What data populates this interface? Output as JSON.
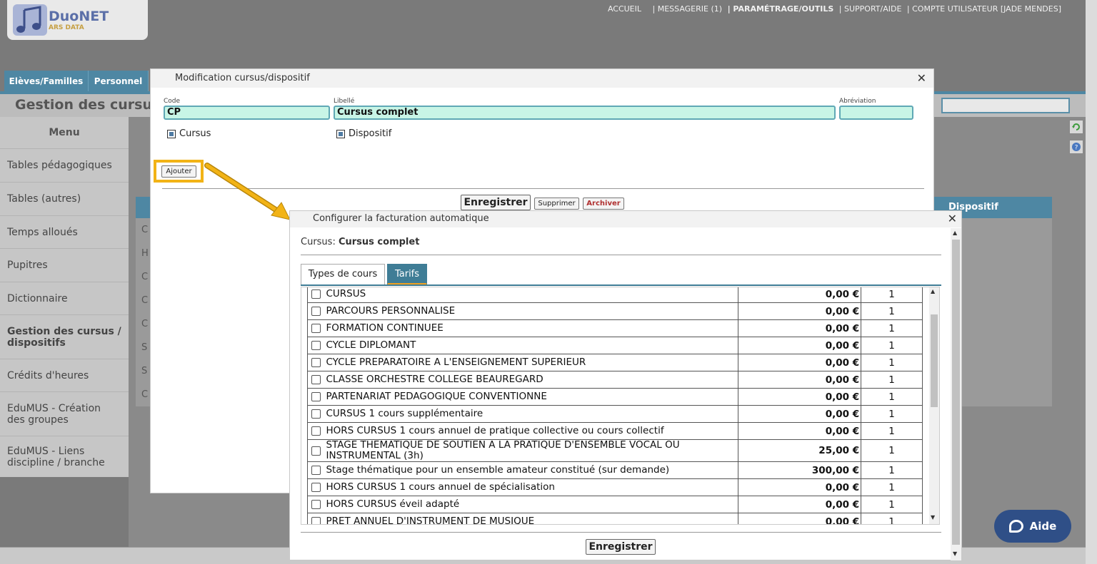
{
  "header": {
    "logo_title": "DuoNET",
    "logo_sub": "ARS DATA",
    "nav": [
      {
        "label": "ACCUEIL",
        "bold": false
      },
      {
        "label": "| MESSAGERIE (1)",
        "bold": false
      },
      {
        "label": "| PARAMÉTRAGE/OUTILS",
        "bold": true
      },
      {
        "label": "| SUPPORT/AIDE",
        "bold": false
      },
      {
        "label": "| COMPTE UTILISATEUR [JADE MENDES]",
        "bold": false
      }
    ]
  },
  "main_tabs": [
    "Elèves/Familles",
    "Personnel"
  ],
  "page": {
    "title": "Gestion des cursus"
  },
  "sidebar": {
    "heading": "Menu",
    "items": [
      "Tables pédagogiques",
      "Tables (autres)",
      "Temps alloués",
      "Pupitres",
      "Dictionnaire",
      "Gestion des cursus / dispositifs",
      "Crédits d'heures",
      "EduMUS - Création des groupes",
      "EduMUS - Liens discipline / branche"
    ],
    "active_index": 5
  },
  "background_table": {
    "header_right": "Dispositif",
    "row_initials": [
      "C",
      "H",
      "C",
      "C",
      "C",
      "S",
      "S",
      "C"
    ]
  },
  "dialog1": {
    "title": "Modification cursus/dispositif",
    "code_label": "Code",
    "code_value": "CP",
    "libelle_label": "Libellé",
    "libelle_value": "Cursus complet",
    "abreviation_label": "Abréviation",
    "abreviation_value": "",
    "checkbox_cursus": "Cursus",
    "checkbox_dispositif": "Dispositif",
    "add_button": "Ajouter",
    "save_button": "Enregistrer",
    "delete_button": "Supprimer",
    "archive_button": "Archiver",
    "archive_color": "#b03030"
  },
  "dialog2": {
    "title": "Configurer la facturation automatique",
    "cursus_label": "Cursus",
    "cursus_value": "Cursus complet",
    "tab_types": "Types de cours",
    "tab_tarifs": "Tarifs",
    "save_button": "Enregistrer",
    "rows": [
      {
        "label": "CURSUS",
        "price": "0,00 €",
        "qty": "1"
      },
      {
        "label": "PARCOURS PERSONNALISE",
        "price": "0,00 €",
        "qty": "1"
      },
      {
        "label": "FORMATION CONTINUEE",
        "price": "0,00 €",
        "qty": "1"
      },
      {
        "label": "CYCLE DIPLOMANT",
        "price": "0,00 €",
        "qty": "1"
      },
      {
        "label": "CYCLE PREPARATOIRE A L'ENSEIGNEMENT SUPERIEUR",
        "price": "0,00 €",
        "qty": "1"
      },
      {
        "label": "CLASSE ORCHESTRE COLLEGE BEAUREGARD",
        "price": "0,00 €",
        "qty": "1"
      },
      {
        "label": "PARTENARIAT PEDAGOGIQUE CONVENTIONNE",
        "price": "0,00 €",
        "qty": "1"
      },
      {
        "label": "CURSUS 1 cours supplémentaire",
        "price": "0,00 €",
        "qty": "1"
      },
      {
        "label": "HORS CURSUS 1 cours annuel de pratique collective ou cours collectif",
        "price": "0,00 €",
        "qty": "1"
      },
      {
        "label": "STAGE THEMATIQUE DE SOUTIEN A LA PRATIQUE D'ENSEMBLE VOCAL OU INSTRUMENTAL (3h)",
        "price": "25,00 €",
        "qty": "1"
      },
      {
        "label": "Stage thématique pour un ensemble amateur constitué (sur demande)",
        "price": "300,00 €",
        "qty": "1"
      },
      {
        "label": "HORS CURSUS 1 cours annuel de spécialisation",
        "price": "0,00 €",
        "qty": "1"
      },
      {
        "label": "HORS CURSUS éveil adapté",
        "price": "0,00 €",
        "qty": "1"
      },
      {
        "label": "PRET ANNUEL D'INSTRUMENT DE MUSIQUE",
        "price": "0,00 €",
        "qty": "1"
      }
    ]
  },
  "help_button": "Aide",
  "colors": {
    "accent": "#4e87a3",
    "field_bg": "#c8f5e6",
    "highlight": "#f2b316",
    "help_bg": "#2f4f87"
  }
}
